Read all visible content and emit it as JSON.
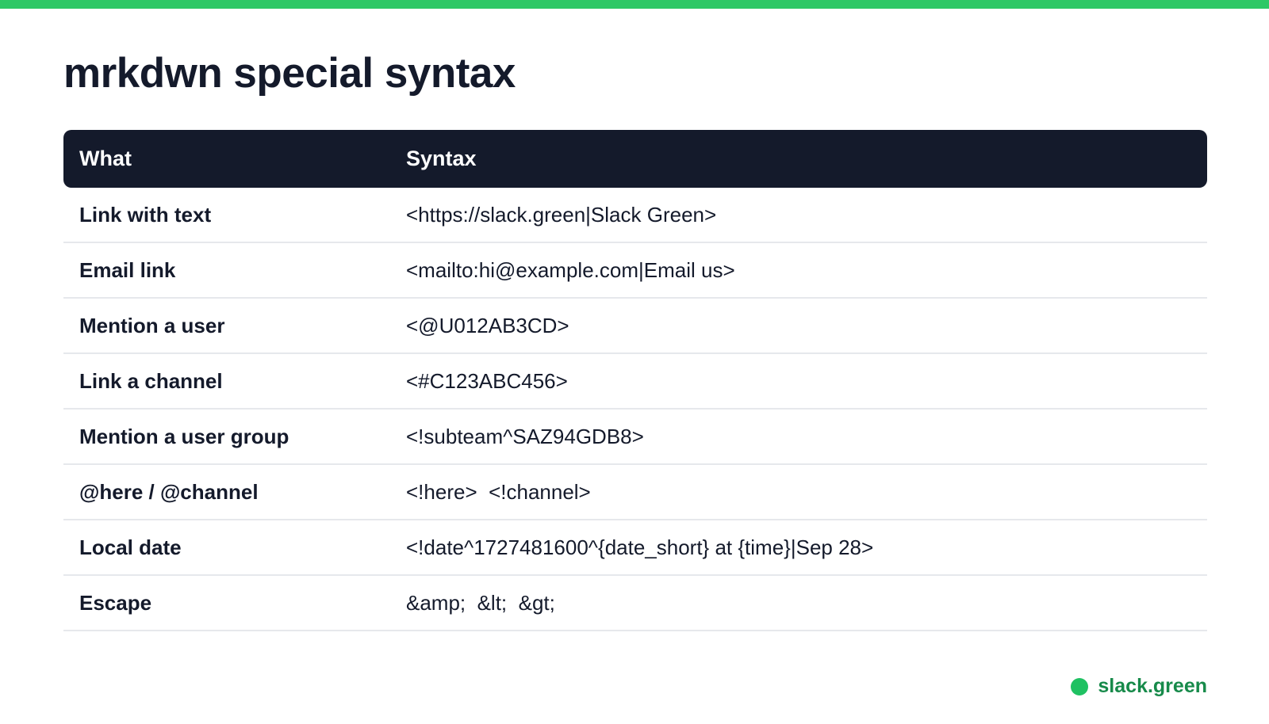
{
  "page": {
    "title": "mrkdwn special syntax"
  },
  "table": {
    "headers": {
      "what": "What",
      "syntax": "Syntax"
    },
    "rows": [
      {
        "what": "Link with text",
        "syntax": "<https://slack.green|Slack Green>"
      },
      {
        "what": "Email link",
        "syntax": "<mailto:hi@example.com|Email us>"
      },
      {
        "what": "Mention a user",
        "syntax": "<@U012AB3CD>"
      },
      {
        "what": "Link a channel",
        "syntax": "<#C123ABC456>"
      },
      {
        "what": "Mention a user group",
        "syntax": "<!subteam^SAZ94GDB8>"
      },
      {
        "what": "@here / @channel",
        "syntax": "<!here>  <!channel>"
      },
      {
        "what": "Local date",
        "syntax": "<!date^1727481600^{date_short} at {time}|Sep 28>"
      },
      {
        "what": "Escape",
        "syntax": "&amp;  &lt;  &gt;"
      }
    ]
  },
  "footer": {
    "brand": "slack.green"
  },
  "colors": {
    "accent": "#2ec866",
    "header_bg": "#141a2b",
    "brand_text": "#178a4a"
  }
}
